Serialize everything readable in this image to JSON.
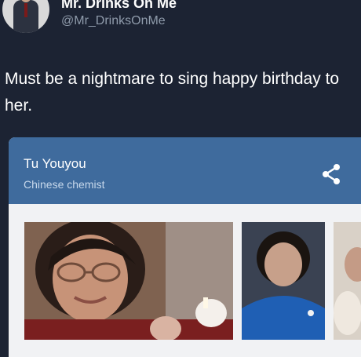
{
  "tweet": {
    "display_name": "Mr. Drinks On Me",
    "handle": "@Mr_DrinksOnMe",
    "text": "Must be a nightmare to sing happy birthday to her."
  },
  "card": {
    "title": "Tu Youyou",
    "subtitle": "Chinese chemist",
    "share_icon": "share-icon"
  },
  "colors": {
    "background": "#1c2333",
    "card_header": "#3f6b9d",
    "card_body": "#f1f2f4"
  }
}
